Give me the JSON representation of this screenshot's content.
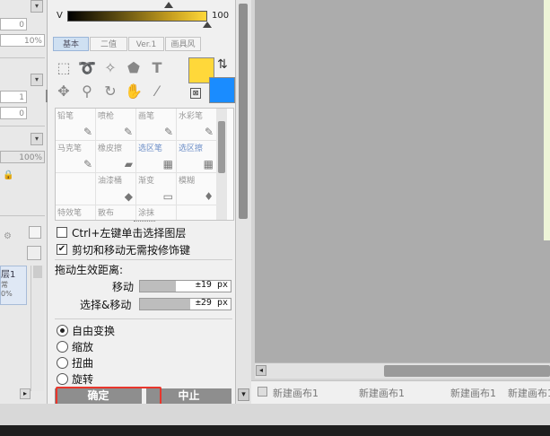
{
  "left_panel": {
    "fields": [
      "0",
      "10%",
      "1",
      "0",
      "100%"
    ],
    "layer_name": "层1",
    "layer_sub1": "常",
    "layer_sub2": "0%"
  },
  "color_bar": {
    "label": "V",
    "value": "100"
  },
  "tabs": [
    {
      "label": "基本",
      "active": true
    },
    {
      "label": "二值",
      "active": false
    },
    {
      "label": "Ver.1",
      "active": false
    },
    {
      "label": "画具风",
      "active": false
    }
  ],
  "colors": {
    "primary": "#ffd83a",
    "secondary": "#1a8cff",
    "canvas_bg": "#acacac",
    "canvas_edge": "#eef5d8",
    "button_gray": "#8e8e8e",
    "highlight_red": "#e8362c"
  },
  "tools": [
    "selection-rect-icon",
    "lasso-icon",
    "magic-wand-icon",
    "bucket-select-icon",
    "text-tool-icon",
    "move-icon",
    "zoom-icon",
    "rotate-icon",
    "hand-icon",
    "eyedropper-icon"
  ],
  "brushes": [
    {
      "name": "铅笔",
      "icon": "✎",
      "blue": false
    },
    {
      "name": "喷枪",
      "icon": "✎",
      "blue": false
    },
    {
      "name": "画笔",
      "icon": "✎",
      "blue": false
    },
    {
      "name": "水彩笔",
      "icon": "✎",
      "blue": false
    },
    {
      "name": "马克笔",
      "icon": "✎",
      "blue": false
    },
    {
      "name": "橡皮擦",
      "icon": "▰",
      "blue": false
    },
    {
      "name": "选区笔",
      "icon": "▦",
      "blue": true
    },
    {
      "name": "选区擦",
      "icon": "▦",
      "blue": true
    },
    {
      "name": "",
      "icon": "",
      "blue": false
    },
    {
      "name": "油漆桶",
      "icon": "◆",
      "blue": false
    },
    {
      "name": "渐变",
      "icon": "▭",
      "blue": false
    },
    {
      "name": "模糊",
      "icon": "♦",
      "blue": false
    },
    {
      "name": "特效笔",
      "icon": "✎",
      "blue": false
    },
    {
      "name": "散布",
      "icon": "✦",
      "blue": false
    },
    {
      "name": "涂抹",
      "icon": "✎",
      "blue": false
    },
    {
      "name": "",
      "icon": "",
      "blue": false
    }
  ],
  "options": {
    "ctrl_select": {
      "label": "Ctrl+左键单击选择图层",
      "checked": false
    },
    "no_modifier": {
      "label": "剪切和移动无需按修饰键",
      "checked": true
    },
    "drag_title": "拖动生效距离:",
    "move": {
      "label": "移动",
      "value": "±19 px",
      "fill": 0.4
    },
    "select_move": {
      "label": "选择&移动",
      "value": "±29 px",
      "fill": 0.55
    }
  },
  "transform": [
    {
      "label": "自由变换",
      "selected": true
    },
    {
      "label": "缩放",
      "selected": false
    },
    {
      "label": "扭曲",
      "selected": false
    },
    {
      "label": "旋转",
      "selected": false
    }
  ],
  "buttons": {
    "ok": "确定",
    "cancel": "中止",
    "menu": "▾"
  },
  "doc_tabs": [
    "新建画布1",
    "新建画布1",
    "新建画布1",
    "新建画布1"
  ]
}
